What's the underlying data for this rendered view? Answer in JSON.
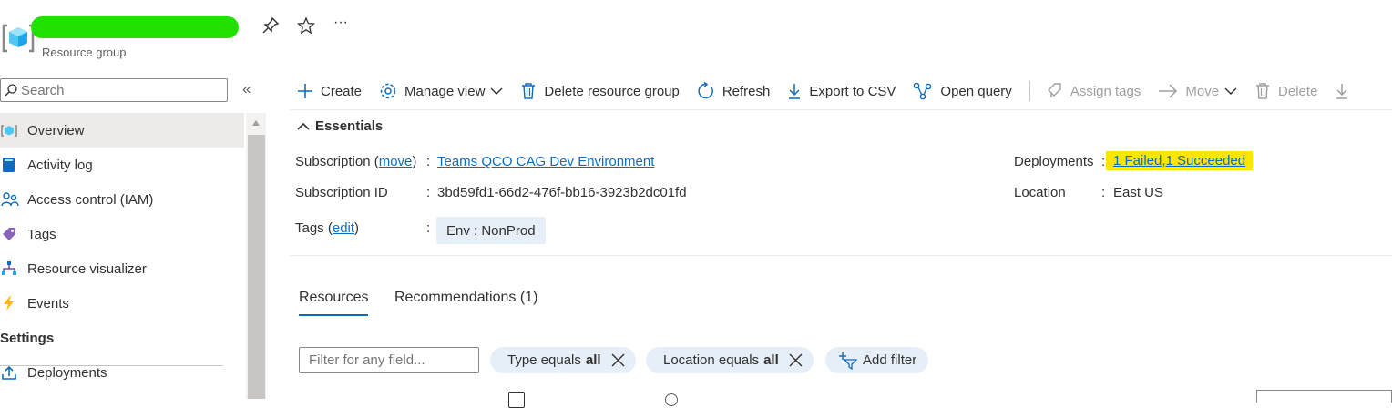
{
  "header": {
    "subtitle": "Resource group",
    "pin_icon": "pin-icon",
    "favorite_icon": "star-icon",
    "more_label": "···"
  },
  "sidebar": {
    "search_placeholder": "Search",
    "collapse_label": "«",
    "items": [
      {
        "label": "Overview",
        "icon": "resource-group-icon",
        "active": true
      },
      {
        "label": "Activity log",
        "icon": "activity-log-icon"
      },
      {
        "label": "Access control (IAM)",
        "icon": "people-icon"
      },
      {
        "label": "Tags",
        "icon": "tag-icon"
      },
      {
        "label": "Resource visualizer",
        "icon": "hierarchy-icon"
      },
      {
        "label": "Events",
        "icon": "lightning-icon"
      }
    ],
    "section_settings": "Settings",
    "settings_items": [
      {
        "label": "Deployments",
        "icon": "upload-icon"
      }
    ]
  },
  "toolbar": {
    "create": "Create",
    "manage_view": "Manage view",
    "delete_rg": "Delete resource group",
    "refresh": "Refresh",
    "export_csv": "Export to CSV",
    "open_query": "Open query",
    "assign_tags": "Assign tags",
    "move": "Move",
    "delete": "Delete"
  },
  "essentials": {
    "title": "Essentials",
    "subscription_label": "Subscription (",
    "subscription_move": "move",
    "subscription_label_end": ")",
    "colon": ":",
    "subscription_value": "Teams QCO CAG Dev Environment",
    "subscription_id_label": "Subscription ID",
    "subscription_id_value": "3bd59fd1-66d2-476f-bb16-3923b2dc01fd",
    "tags_label": "Tags (",
    "tags_edit": "edit",
    "tags_label_end": ")",
    "tag_value": "Env : NonProd",
    "deployments_label": "Deployments",
    "deployments_value": "1 Failed,1 Succeeded",
    "location_label": "Location",
    "location_value": "East US"
  },
  "tabs": {
    "resources": "Resources",
    "recommendations": "Recommendations (1)"
  },
  "filters": {
    "placeholder": "Filter for any field...",
    "type_prefix": "Type equals",
    "type_value": "all",
    "location_prefix": "Location equals",
    "location_value": "all",
    "add_filter": "Add filter"
  },
  "colors": {
    "accent": "#0f6cbd",
    "highlight": "#ffe600",
    "redaction": "#22e000",
    "pill_bg": "#e6eef8"
  }
}
